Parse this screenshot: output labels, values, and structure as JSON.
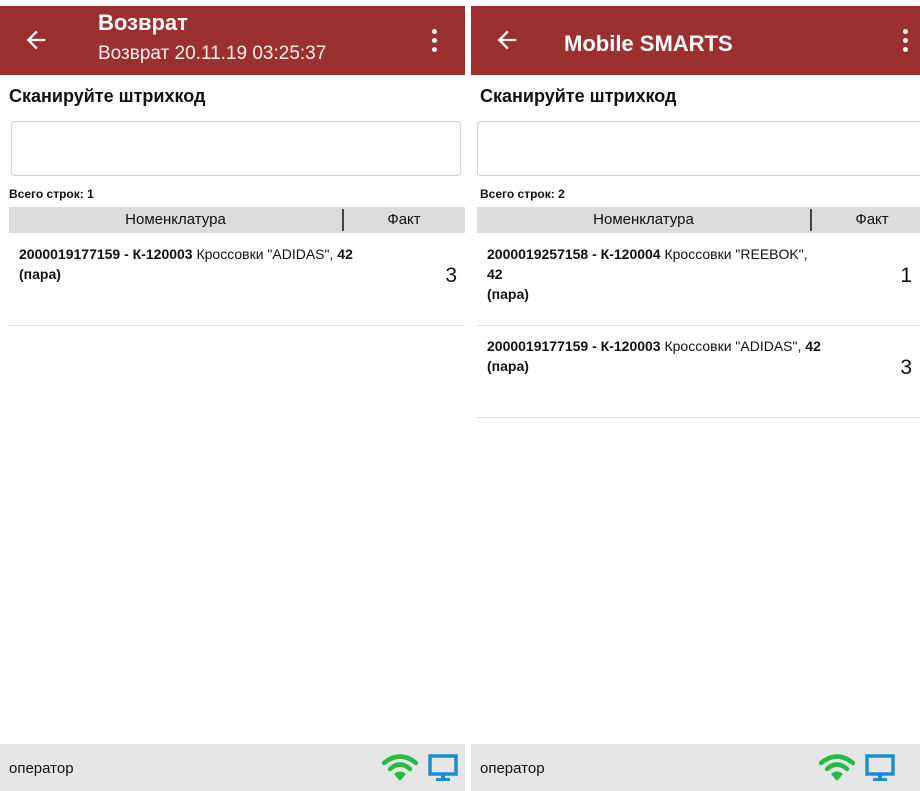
{
  "left": {
    "title": "Возврат",
    "subtitle": "Возврат 20.11.19 03:25:37",
    "scan_label": "Сканируйте штрихкод",
    "scan_input_value": "",
    "total_rows": "Всего строк: 1",
    "columns": {
      "name": "Номенклатура",
      "fact": "Факт"
    },
    "rows": [
      {
        "code": "2000019177159 - К-120003",
        "name": " Кроссовки \"ADIDAS\",",
        "size": " 42",
        "unit": "(пара)",
        "qty": "3"
      }
    ],
    "footer": "оператор"
  },
  "right": {
    "title": "Mobile SMARTS",
    "scan_label": "Сканируйте штрихкод",
    "scan_input_value": "",
    "total_rows": "Всего строк: 2",
    "columns": {
      "name": "Номенклатура",
      "fact": "Факт"
    },
    "rows": [
      {
        "code": "2000019257158 - К-120004",
        "name": " Кроссовки \"REEBOK\",",
        "size": " 42",
        "unit": "(пара)",
        "qty": "1"
      },
      {
        "code": "2000019177159 - К-120003",
        "name": " Кроссовки \"ADIDAS\",",
        "size": " 42",
        "unit": "(пара)",
        "qty": "3"
      }
    ],
    "footer": "оператор"
  },
  "colors": {
    "appbar": "#9c2f2f",
    "wifi": "#22bb44",
    "monitor": "#1a8fd0",
    "footer": "#e6e6e6"
  },
  "icons": [
    "back-arrow-icon",
    "more-vert-icon",
    "wifi-icon",
    "monitor-icon"
  ]
}
